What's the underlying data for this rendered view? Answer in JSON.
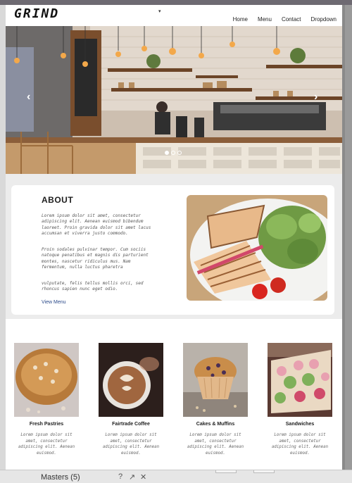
{
  "site": {
    "logo": "GRIND",
    "nav": [
      {
        "label": "Home"
      },
      {
        "label": "Menu"
      },
      {
        "label": "Contact"
      },
      {
        "label": "Dropdown"
      }
    ],
    "nav_caret": "▾"
  },
  "hero": {
    "prev_arrow": "‹",
    "next_arrow": "›",
    "slide_count": 3,
    "active_slide": 1
  },
  "about": {
    "title": "ABOUT",
    "paragraphs": [
      "Lorem ipsum dolor sit amet, consectetur adipiscing elit. Aenean euismod bibendum laoreet. Proin gravida dolor sit amet lacus accumsan et viverra justo commodo.",
      "Proin sodales pulvinar tempor. Cum sociis natoque penatibus et magnis dis parturient montes, nascetur ridiculus mus. Nam fermentum, nulla luctus pharetra",
      "vulputate, felis tellus mollis orci, sed rhoncus sapien nunc eget odio."
    ],
    "link": "View Menu"
  },
  "products": [
    {
      "name": "Fresh Pastries",
      "desc": "Lorem ipsum dolor sit amet, consectetur adipiscing elit. Aenean euismod."
    },
    {
      "name": "Fairtrade Coffee",
      "desc": "Lorem ipsum dolor sit amet, consectetur adipiscing elit. Aenean euismod."
    },
    {
      "name": "Cakes & Muffins",
      "desc": "Lorem ipsum dolor sit amet, consectetur adipiscing elit. Aenean euismod."
    },
    {
      "name": "Sandwiches",
      "desc": "Lorem ipsum dolor sit amet, consectetur adipiscing elit. Aenean euismod."
    }
  ],
  "app_chrome": {
    "panel_label": "Masters (5)",
    "tools": [
      "?",
      "↗",
      "✕"
    ]
  },
  "colors": {
    "link": "#2b4a8a",
    "band": "#ececec"
  }
}
